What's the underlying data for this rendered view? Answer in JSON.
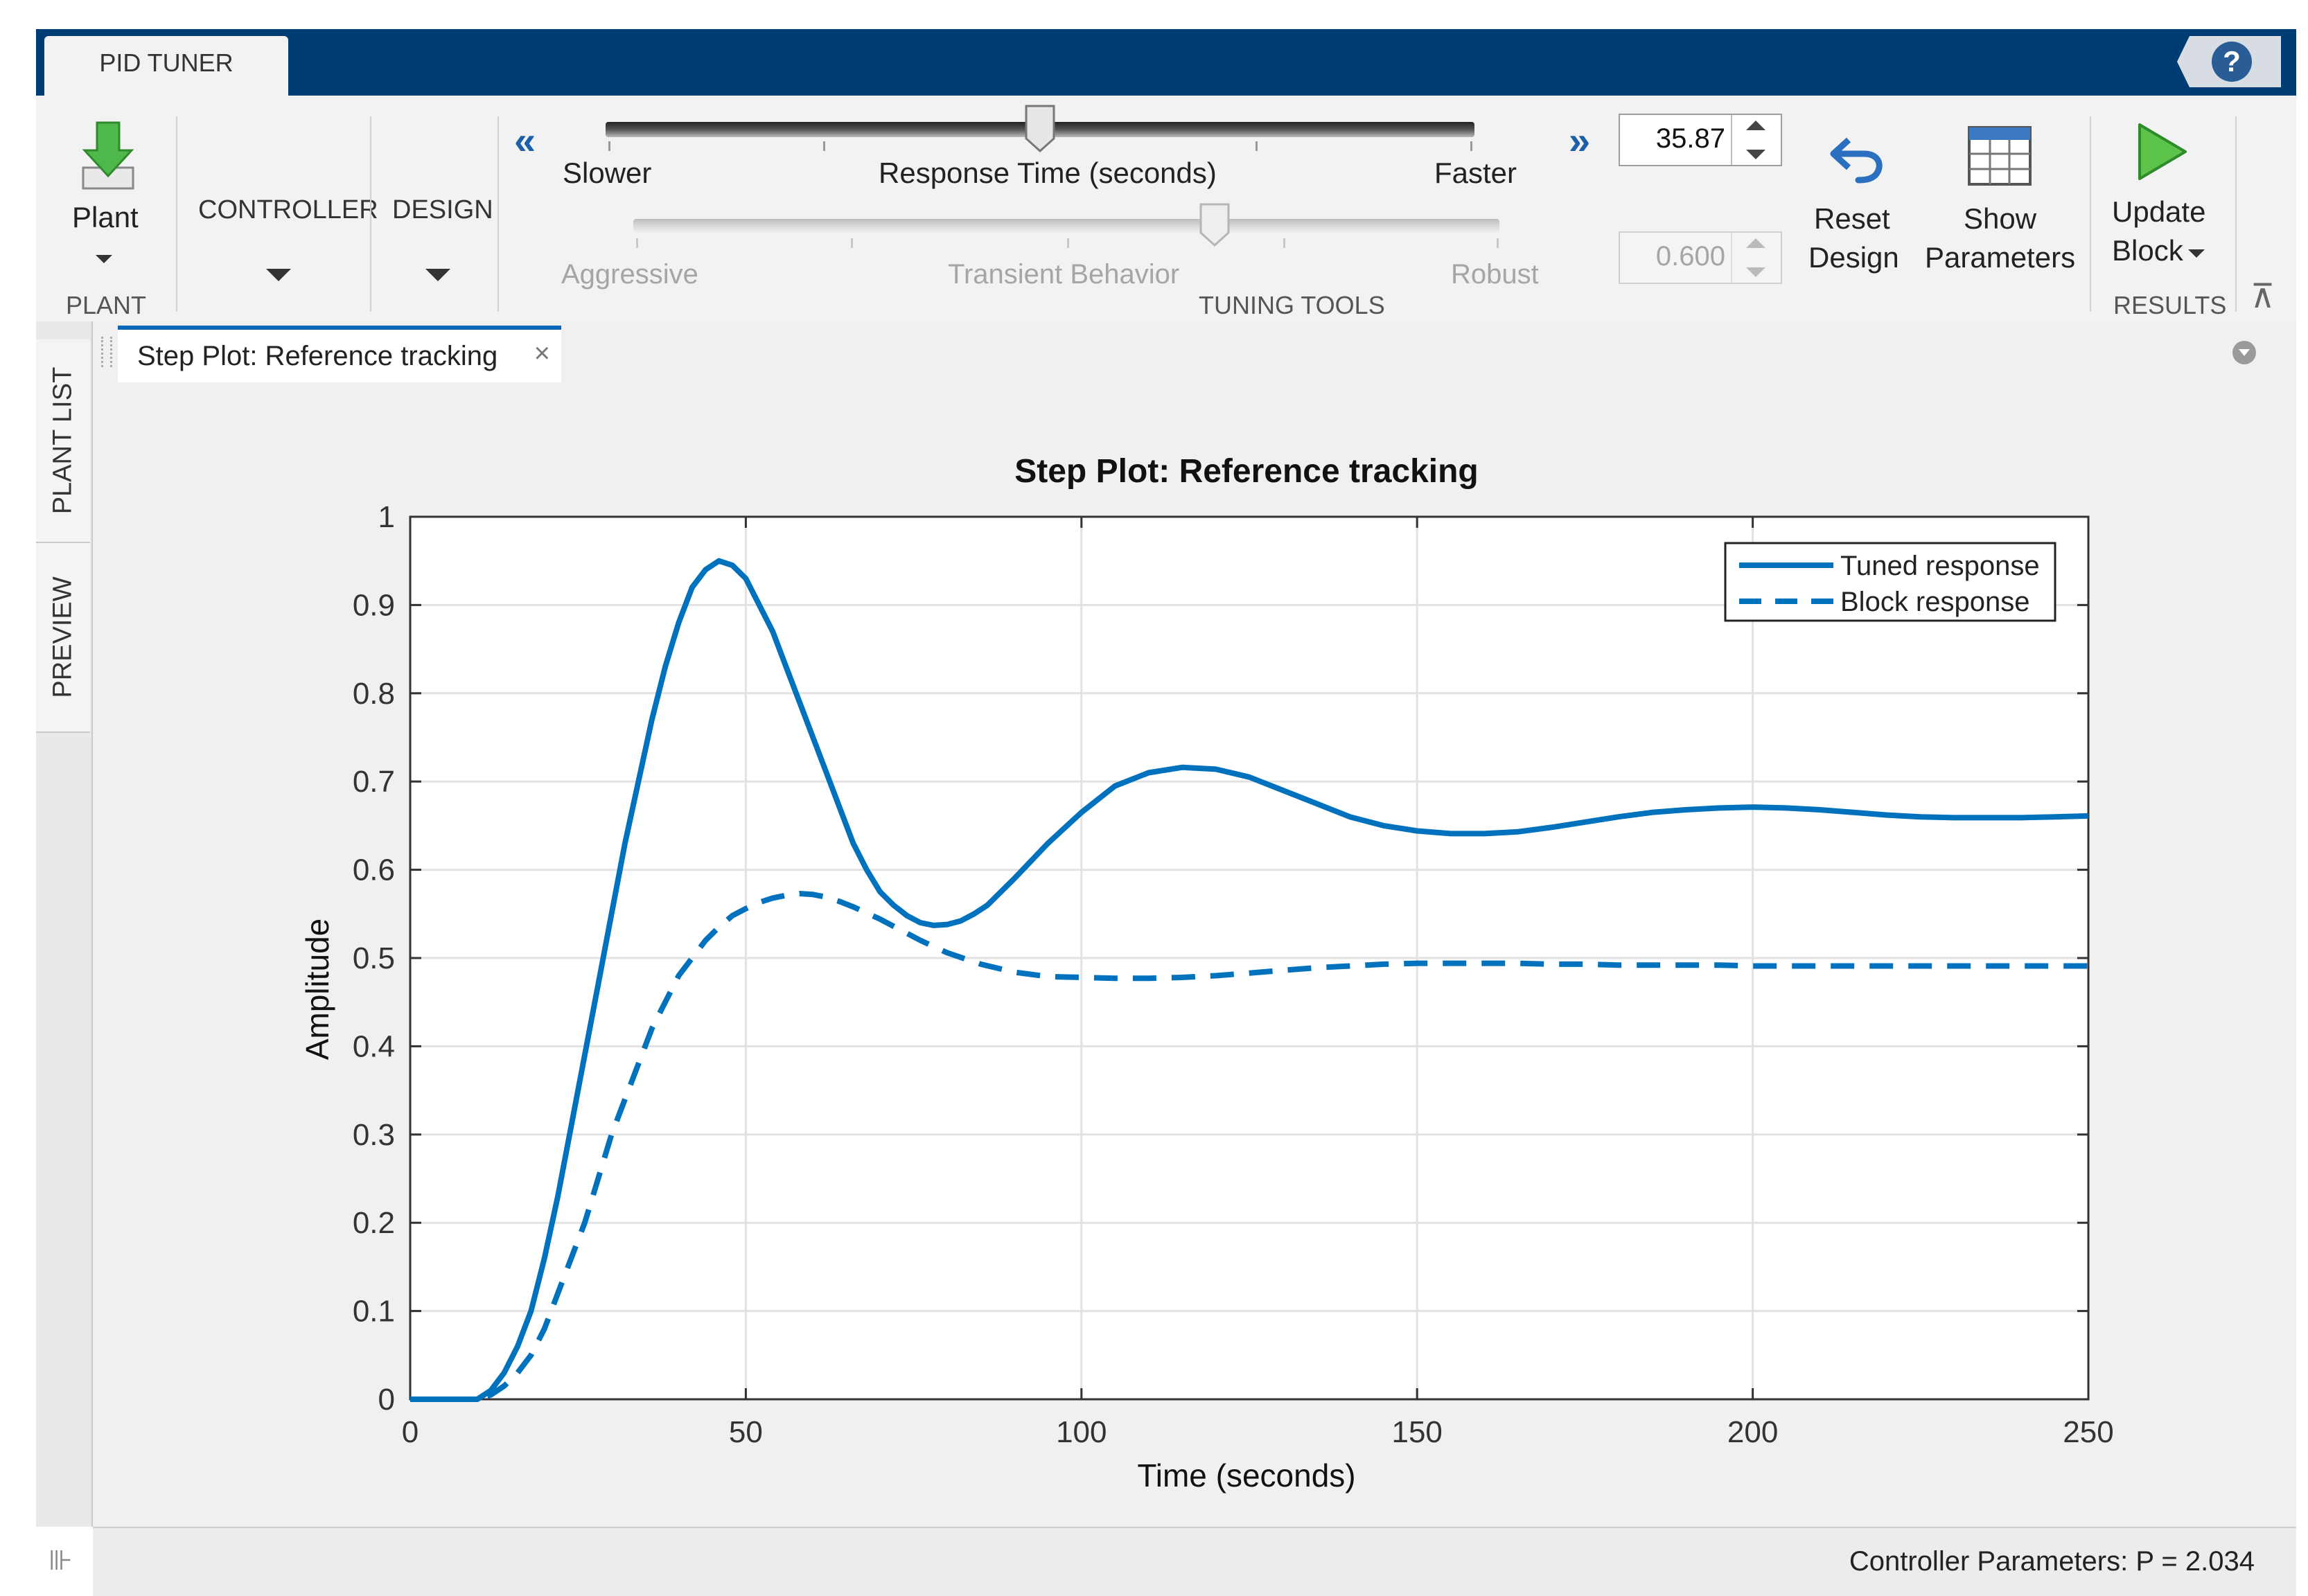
{
  "app": {
    "tab_label": "PID TUNER",
    "help_label": "?"
  },
  "toolstrip": {
    "plant": {
      "button_label": "Plant",
      "section": "PLANT"
    },
    "controller": {
      "label": "CONTROLLER"
    },
    "design": {
      "label": "DESIGN"
    },
    "tuning": {
      "section": "TUNING TOOLS",
      "left_arrow": "«",
      "right_arrow": "»",
      "response_slider": {
        "left": "Slower",
        "center": "Response Time (seconds)",
        "right": "Faster",
        "position": 0.5,
        "value": "35.87"
      },
      "transient_slider": {
        "left": "Aggressive",
        "center": "Transient Behavior",
        "right": "Robust",
        "position": 0.67,
        "value": "0.600"
      }
    },
    "reset": {
      "line1": "Reset",
      "line2": "Design"
    },
    "show": {
      "line1": "Show",
      "line2": "Parameters"
    },
    "update": {
      "line1": "Update",
      "line2": "Block",
      "section": "RESULTS"
    },
    "collapse_label": "⊼"
  },
  "sidebar": {
    "tabs": [
      "PLANT LIST",
      "PREVIEW"
    ]
  },
  "document": {
    "tab_title": "Step Plot: Reference tracking",
    "close": "×"
  },
  "status": {
    "text": "Controller Parameters: P = 2.034"
  },
  "colors": {
    "accent": "#0072bd",
    "titlebar": "#003c74"
  },
  "chart_data": {
    "type": "line",
    "title": "Step Plot: Reference tracking",
    "xlabel": "Time (seconds)",
    "ylabel": "Amplitude",
    "xlim": [
      0,
      250
    ],
    "ylim": [
      0,
      1
    ],
    "xticks": [
      0,
      50,
      100,
      150,
      200,
      250
    ],
    "yticks": [
      0,
      0.1,
      0.2,
      0.3,
      0.4,
      0.5,
      0.6,
      0.7,
      0.8,
      0.9,
      1
    ],
    "grid": true,
    "legend_position": "top-right",
    "series": [
      {
        "name": "Tuned response",
        "style": "solid",
        "x": [
          0,
          10,
          12,
          14,
          16,
          18,
          20,
          22,
          24,
          26,
          28,
          30,
          32,
          34,
          36,
          38,
          40,
          42,
          44,
          46,
          48,
          50,
          52,
          54,
          56,
          58,
          60,
          62,
          64,
          66,
          68,
          70,
          72,
          74,
          76,
          78,
          80,
          82,
          84,
          86,
          88,
          90,
          95,
          100,
          105,
          110,
          115,
          120,
          125,
          130,
          135,
          140,
          145,
          150,
          155,
          160,
          165,
          170,
          175,
          180,
          185,
          190,
          195,
          200,
          205,
          210,
          215,
          220,
          225,
          230,
          235,
          240,
          245,
          250
        ],
        "y": [
          0,
          0,
          0.01,
          0.03,
          0.06,
          0.1,
          0.16,
          0.23,
          0.31,
          0.39,
          0.47,
          0.55,
          0.63,
          0.7,
          0.77,
          0.83,
          0.88,
          0.92,
          0.94,
          0.95,
          0.945,
          0.93,
          0.9,
          0.87,
          0.83,
          0.79,
          0.75,
          0.71,
          0.67,
          0.63,
          0.6,
          0.575,
          0.56,
          0.548,
          0.54,
          0.537,
          0.538,
          0.542,
          0.55,
          0.56,
          0.575,
          0.59,
          0.63,
          0.665,
          0.695,
          0.71,
          0.716,
          0.714,
          0.705,
          0.69,
          0.675,
          0.66,
          0.65,
          0.644,
          0.641,
          0.641,
          0.643,
          0.648,
          0.654,
          0.66,
          0.665,
          0.668,
          0.67,
          0.671,
          0.67,
          0.668,
          0.665,
          0.662,
          0.66,
          0.659,
          0.659,
          0.659,
          0.66,
          0.661
        ]
      },
      {
        "name": "Block response",
        "style": "dashed",
        "x": [
          0,
          10,
          12,
          14,
          16,
          18,
          20,
          22,
          24,
          26,
          28,
          30,
          32,
          34,
          36,
          38,
          40,
          42,
          44,
          46,
          48,
          50,
          52,
          54,
          56,
          58,
          60,
          62,
          64,
          66,
          68,
          70,
          72,
          74,
          76,
          78,
          80,
          85,
          90,
          95,
          100,
          105,
          110,
          115,
          120,
          125,
          130,
          135,
          140,
          145,
          150,
          155,
          160,
          165,
          170,
          175,
          180,
          185,
          190,
          195,
          200,
          205,
          210,
          215,
          220,
          225,
          230,
          235,
          240,
          245,
          250
        ],
        "y": [
          0,
          0,
          0.005,
          0.015,
          0.03,
          0.05,
          0.08,
          0.12,
          0.16,
          0.2,
          0.25,
          0.3,
          0.34,
          0.38,
          0.42,
          0.45,
          0.48,
          0.5,
          0.52,
          0.535,
          0.548,
          0.556,
          0.563,
          0.568,
          0.571,
          0.573,
          0.572,
          0.569,
          0.564,
          0.558,
          0.551,
          0.544,
          0.536,
          0.528,
          0.52,
          0.513,
          0.506,
          0.493,
          0.484,
          0.479,
          0.478,
          0.477,
          0.477,
          0.478,
          0.48,
          0.483,
          0.486,
          0.489,
          0.491,
          0.493,
          0.494,
          0.494,
          0.494,
          0.494,
          0.493,
          0.493,
          0.492,
          0.492,
          0.492,
          0.492,
          0.491,
          0.491,
          0.491,
          0.491,
          0.491,
          0.491,
          0.491,
          0.491,
          0.491,
          0.491,
          0.491
        ]
      }
    ]
  }
}
